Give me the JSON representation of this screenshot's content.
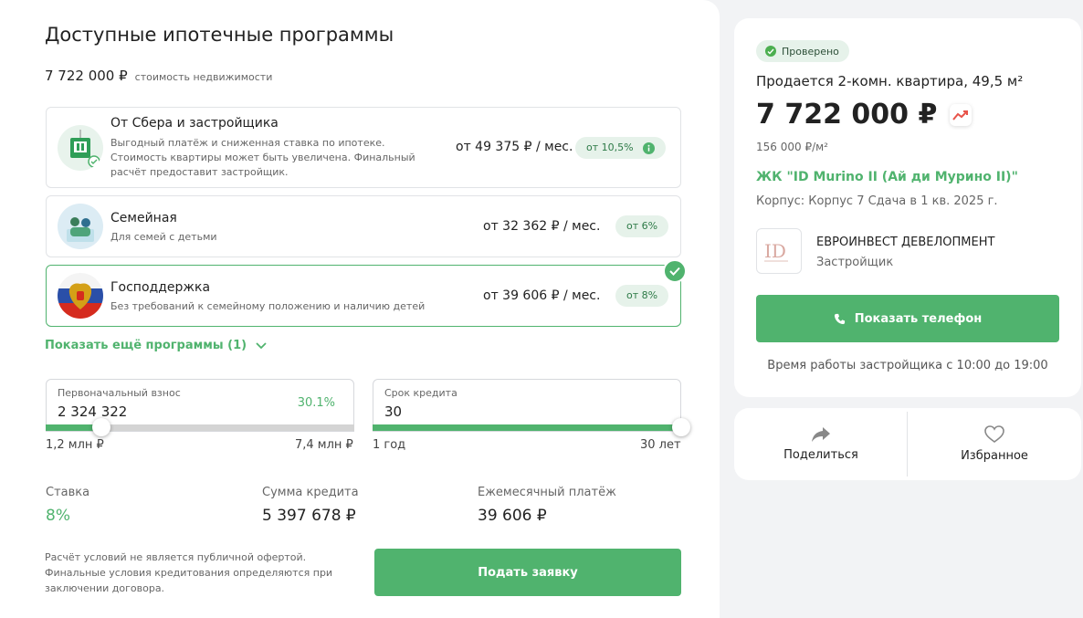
{
  "mortgage": {
    "title": "Доступные ипотечные программы",
    "property_price": "7 722 000 ₽",
    "property_price_label": "стоимость недвижимости",
    "programs": [
      {
        "name": "От Сбера и застройщика",
        "description": "Выгодный платёж и сниженная ставка по ипотеке. Стоимость квартиры может быть увеличена. Финальный расчёт предоставит застройщик.",
        "payment": "от 49 375 ₽ / мес.",
        "rate": "от 10,5%",
        "icon": "sber-developer-icon",
        "selected": false
      },
      {
        "name": "Семейная",
        "description": "Для семей с детьми",
        "payment": "от 32 362 ₽ / мес.",
        "rate": "от 6%",
        "icon": "family-icon",
        "selected": false
      },
      {
        "name": "Господдержка",
        "description": "Без требований к семейному положению и наличию детей",
        "payment": "от 39 606 ₽ / мес.",
        "rate": "от 8%",
        "icon": "russia-coat-of-arms-icon",
        "selected": true
      }
    ],
    "show_more": "Показать ещё программы (1)",
    "down_payment": {
      "label": "Первоначальный взнос",
      "value": "2 324 322",
      "percent": "30.1%",
      "min": "1,2 млн ₽",
      "max": "7,4 млн ₽",
      "level": 0.18
    },
    "term": {
      "label": "Срок кредита",
      "value": "30",
      "min": "1 год",
      "max": "30 лет",
      "level": 1.0
    },
    "rate_label": "Ставка",
    "rate_value": "8%",
    "loan_label": "Сумма кредита",
    "loan_value": "5 397 678 ₽",
    "monthly_label": "Ежемесячный платёж",
    "monthly_value": "39 606 ₽",
    "disclaimer": "Расчёт условий не является публичной офертой. Финальные условия кредитования определяются при заключении договора.",
    "apply_button": "Подать заявку"
  },
  "listing": {
    "verified": "Проверено",
    "flat": "Продается 2-комн. квартира, 49,5 м²",
    "price": "7 722 000 ₽",
    "price_per_m2": "156 000 ₽/м²",
    "complex": "ЖК \"ID Murino II (Ай ди Мурино II)\"",
    "building": "Корпус: Корпус 7   Сдача в 1 кв. 2025 г.",
    "developer_name": "ЕВРОИНВЕСТ ДЕВЕЛОПМЕНТ",
    "developer_role": "Застройщик",
    "phone_button": "Показать телефон",
    "hours": "Время работы застройщика с 10:00 до 19:00"
  },
  "actions": {
    "share": "Поделиться",
    "favorite": "Избранное"
  },
  "colors": {
    "accent": "#50b36e",
    "accent_light": "#e6f2ea"
  }
}
